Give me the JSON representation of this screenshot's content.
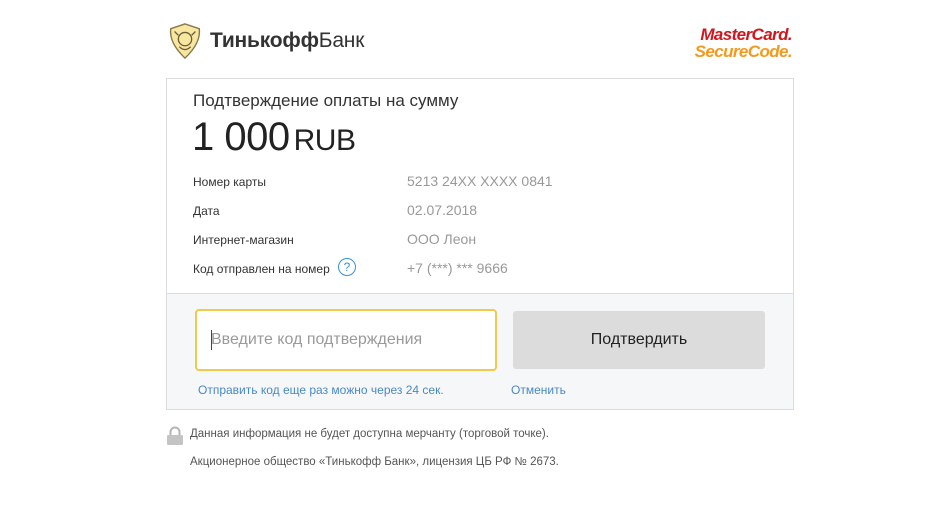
{
  "header": {
    "bank_name_bold": "Тинькофф",
    "bank_name_rest": "Банк",
    "mc_line1": "MasterCard.",
    "mc_line2": "SecureCode."
  },
  "payment": {
    "title": "Подтверждение оплаты на сумму",
    "amount": "1 000",
    "currency": "RUB",
    "rows": [
      {
        "label": "Номер карты",
        "value": "5213 24XX XXXX 0841"
      },
      {
        "label": "Дата",
        "value": "02.07.2018"
      },
      {
        "label": "Интернет-магазин",
        "value": "ООО Леон"
      },
      {
        "label": "Код отправлен на номер",
        "value": "+7 (***) *** 9666",
        "help": "?"
      }
    ]
  },
  "form": {
    "code_placeholder": "Введите код подтверждения",
    "confirm_label": "Подтвердить",
    "resend_text": "Отправить код еще раз можно через 24 сек.",
    "cancel_label": "Отменить"
  },
  "footer": {
    "note": "Данная информация не будет доступна мерчанту (торговой точке).",
    "legal": "Акционерное общество «Тинькофф Банк», лицензия ЦБ РФ № 2673."
  },
  "colors": {
    "accent_yellow": "#f2c94c",
    "link_blue": "#4a88c5",
    "button_gray": "#dcdcdc"
  }
}
